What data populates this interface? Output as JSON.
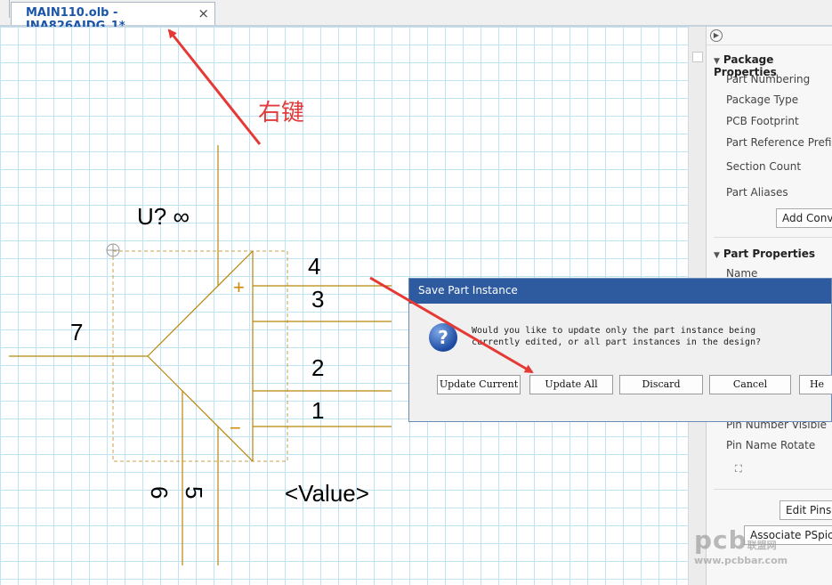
{
  "tab": {
    "title": "MAIN110.olb - INA826AIDG_1*",
    "close": "×"
  },
  "schematic": {
    "ref": "U? ∞",
    "value": "<Value>",
    "plus": "+",
    "minus": "−",
    "pins": [
      "4",
      "3",
      "7",
      "2",
      "1",
      "6",
      "5"
    ]
  },
  "annotation": {
    "text": "右键"
  },
  "panel": {
    "package_section": "Package Properties",
    "package_items": [
      "Part Numbering",
      "Package Type",
      "PCB Footprint",
      "Part Reference Prefix",
      "Section Count",
      "Part Aliases"
    ],
    "add_convert": "Add Conve",
    "part_section": "Part Properties",
    "part_items": [
      "Name",
      "Pin Number Visible",
      "Pin Name Rotate"
    ],
    "edit_pins": "Edit Pins",
    "associate_pspice": "Associate PSpice"
  },
  "dialog": {
    "title": "Save Part Instance",
    "message_line1": "Would you like to update only the part instance being",
    "message_line2": "currently edited, or all part instances in the design?",
    "buttons": [
      "Update Current",
      "Update All",
      "Discard",
      "Cancel",
      "He"
    ]
  },
  "watermark": {
    "brand": "pcb",
    "cn": "联盟网",
    "url": "www.pcbbar.com"
  },
  "colors": {
    "arrow": "#e53935",
    "symbol": "#b8860b",
    "grid": "#bfe3f5",
    "dialog_title_bar": "#2e5aa0"
  }
}
